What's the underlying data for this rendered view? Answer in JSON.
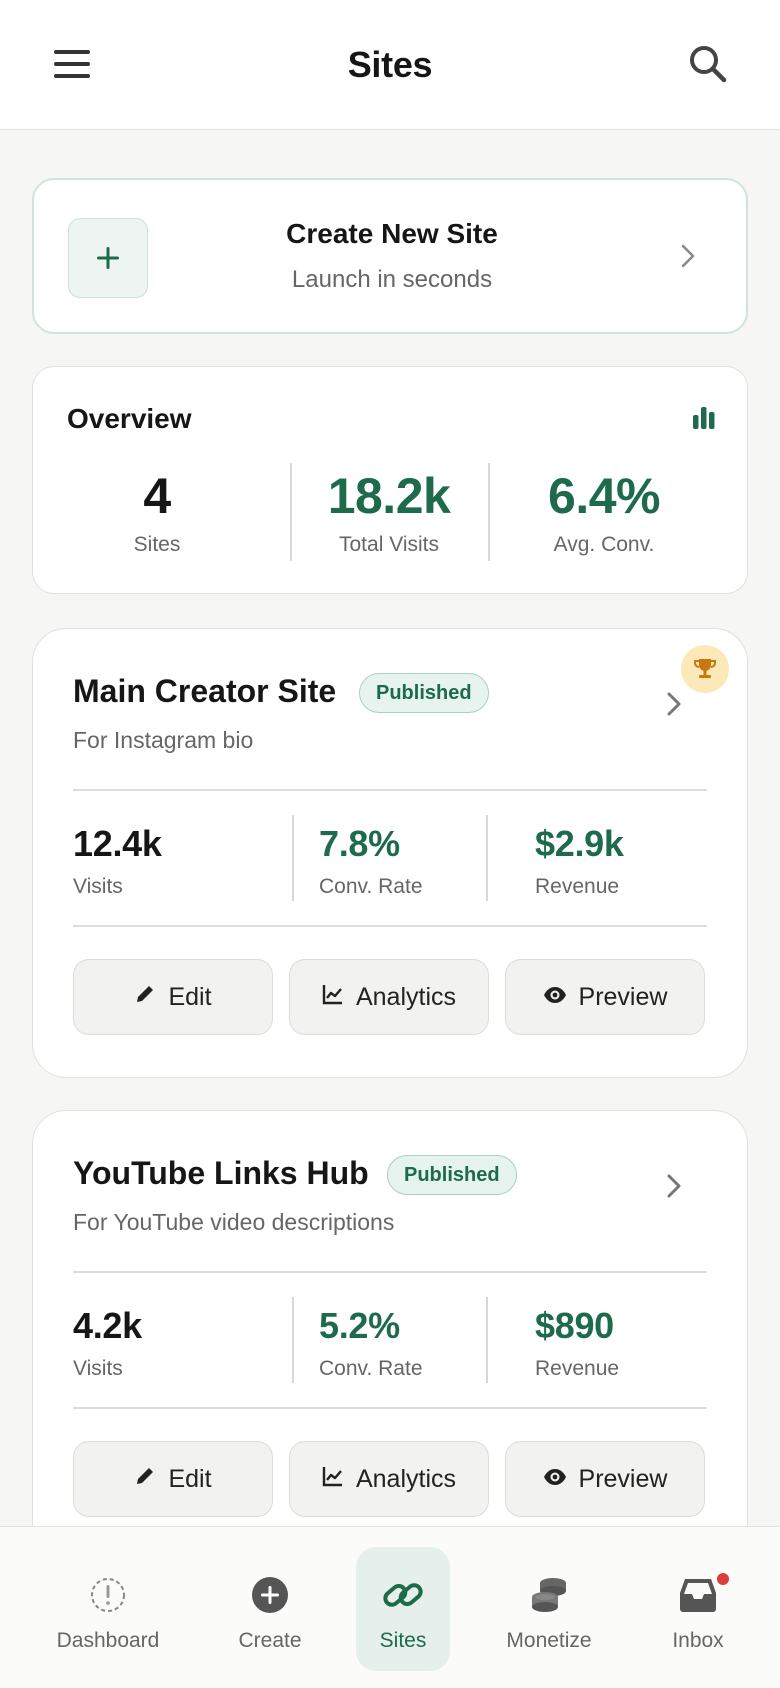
{
  "header": {
    "title": "Sites"
  },
  "create": {
    "title": "Create New Site",
    "subtitle": "Launch in seconds"
  },
  "overview": {
    "title": "Overview",
    "stats": [
      {
        "value": "4",
        "label": "Sites"
      },
      {
        "value": "18.2k",
        "label": "Total Visits"
      },
      {
        "value": "6.4%",
        "label": "Avg. Conv."
      }
    ]
  },
  "sites": [
    {
      "name": "Main Creator Site",
      "status": "Published",
      "description": "For Instagram bio",
      "top_performer": true,
      "metrics": [
        {
          "value": "12.4k",
          "label": "Visits"
        },
        {
          "value": "7.8%",
          "label": "Conv. Rate"
        },
        {
          "value": "$2.9k",
          "label": "Revenue"
        }
      ],
      "actions": [
        "Edit",
        "Analytics",
        "Preview"
      ]
    },
    {
      "name": "YouTube Links Hub",
      "status": "Published",
      "description": "For YouTube video descriptions",
      "top_performer": false,
      "metrics": [
        {
          "value": "4.2k",
          "label": "Visits"
        },
        {
          "value": "5.2%",
          "label": "Conv. Rate"
        },
        {
          "value": "$890",
          "label": "Revenue"
        }
      ],
      "actions": [
        "Edit",
        "Analytics",
        "Preview"
      ]
    }
  ],
  "nav": {
    "items": [
      {
        "label": "Dashboard",
        "icon": "dashboard-icon"
      },
      {
        "label": "Create",
        "icon": "plus-circle-icon"
      },
      {
        "label": "Sites",
        "icon": "link-icon",
        "active": true
      },
      {
        "label": "Monetize",
        "icon": "coins-icon"
      },
      {
        "label": "Inbox",
        "icon": "inbox-icon",
        "has_notification": true
      }
    ]
  },
  "colors": {
    "accent": "#1e6b4c",
    "badge_bg": "#e7f3ee",
    "trophy_bg": "#fde9b8",
    "notification": "#e03b3b"
  }
}
